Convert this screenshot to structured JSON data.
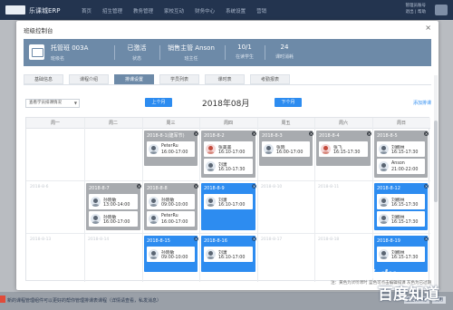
{
  "app": {
    "name": "乐课城ERP",
    "nav": [
      "首页",
      "招生管理",
      "教务管理",
      "家校互动",
      "财务中心",
      "系统设置",
      "营销"
    ],
    "top_right": [
      "管理员账号",
      "退出 | 帮助"
    ]
  },
  "modal": {
    "title": "班级控制台",
    "close_icon": "close-icon"
  },
  "info": {
    "items": [
      {
        "value": "托管班 003A",
        "label": "班级名"
      },
      {
        "value": "已激活",
        "label": "状态"
      },
      {
        "value": "销售主管 Anson",
        "label": "班主任"
      },
      {
        "value": "10/1",
        "label": "在读学生"
      },
      {
        "value": "24",
        "label": "课时消耗"
      }
    ]
  },
  "tabs": [
    {
      "label": "基础信息",
      "active": false
    },
    {
      "label": "课程介绍",
      "active": false
    },
    {
      "label": "排课设置",
      "active": true
    },
    {
      "label": "学员列表",
      "active": false
    },
    {
      "label": "课时表",
      "active": false
    },
    {
      "label": "考勤报表",
      "active": false
    }
  ],
  "calendar": {
    "view_select": "查看学员排课情况",
    "prev_label": "上个月",
    "next_label": "下个月",
    "month": "2018年08月",
    "add_label": "添加排课",
    "weekdays": [
      "周一",
      "周二",
      "周三",
      "周四",
      "周五",
      "周六",
      "周日"
    ],
    "empty_dates": {
      "r1": [
        "",
        "",
        "",
        "",
        "",
        "",
        ""
      ],
      "r2": [
        "2018-8-6",
        "",
        "",
        "",
        "2018-8-10",
        "2018-8-11",
        ""
      ],
      "r3": [
        "2018-8-13",
        "2018-8-14",
        "",
        "",
        "2018-8-17",
        "2018-8-18",
        ""
      ]
    },
    "cards": [
      {
        "date": "2018-8-1(建军节)",
        "entries": [
          {
            "name": "PeterRu",
            "time": "16:00-17:00",
            "g": "m"
          }
        ]
      },
      {
        "date": "2018-8-2",
        "entries": [
          {
            "name": "张美美",
            "time": "16:10-17:00",
            "g": "f"
          },
          {
            "name": "刘潇",
            "time": "16:10-17:30",
            "g": "m"
          }
        ]
      },
      {
        "date": "2018-8-3",
        "entries": [
          {
            "name": "张晓",
            "time": "16:00-17:00",
            "g": "m"
          }
        ]
      },
      {
        "date": "2018-8-4",
        "entries": [
          {
            "name": "张飞",
            "time": "16:15-17:30",
            "g": "f"
          }
        ]
      },
      {
        "date": "2018-8-5",
        "entries": [
          {
            "name": "刘娜林",
            "time": "16:15-17:30",
            "g": "m"
          },
          {
            "name": "Anson",
            "time": "21:00-22:00",
            "g": "m"
          }
        ]
      },
      {
        "date": "2018-8-7",
        "entries": [
          {
            "name": "孙晓敏",
            "time": "13:00-14:00",
            "g": "m"
          },
          {
            "name": "孙晓敏",
            "time": "16:00-17:00",
            "g": "m"
          }
        ]
      },
      {
        "date": "2018-8-8",
        "entries": [
          {
            "name": "孙晓敏",
            "time": "09:00-10:00",
            "g": "m"
          },
          {
            "name": "PeterRu",
            "time": "16:00-17:00",
            "g": "m"
          }
        ]
      },
      {
        "date": "2018-8-9",
        "entries": [
          {
            "name": "刘潇",
            "time": "16:10-17:00",
            "g": "m"
          }
        ]
      },
      {
        "date": "2018-8-12",
        "entries": [
          {
            "name": "刘娜林",
            "time": "16:15-17:30",
            "g": "m"
          },
          {
            "name": "刘娜林",
            "time": "16:15-17:30",
            "g": "m"
          }
        ]
      },
      {
        "date": "2018-8-15",
        "entries": [
          {
            "name": "孙晓敏",
            "time": "09:00-10:00",
            "g": "m"
          }
        ]
      },
      {
        "date": "2018-8-16",
        "entries": [
          {
            "name": "刘潇",
            "time": "16:10-17:00",
            "g": "m"
          }
        ]
      },
      {
        "date": "2018-8-19",
        "entries": [
          {
            "name": "刘娜林",
            "time": "16:15-17:30",
            "g": "m"
          }
        ]
      }
    ],
    "footnote": "注：黄色为试听课时 蓝色可点击编辑排课 灰色为已过期"
  },
  "bottom": {
    "notice": "新的课程管理组件可以更好的帮你管理排课表课程（详情请查看，私发消息）",
    "right_labels": [
      "企业微课程",
      "试用"
    ]
  },
  "watermark": {
    "line1": "Bai du",
    "line2": "jingyan",
    "line3": "百度知道"
  },
  "colors": {
    "past_card": "#a8abaf",
    "editable_card": "#2d8cf0",
    "info_bar": "#6d8aa8"
  }
}
